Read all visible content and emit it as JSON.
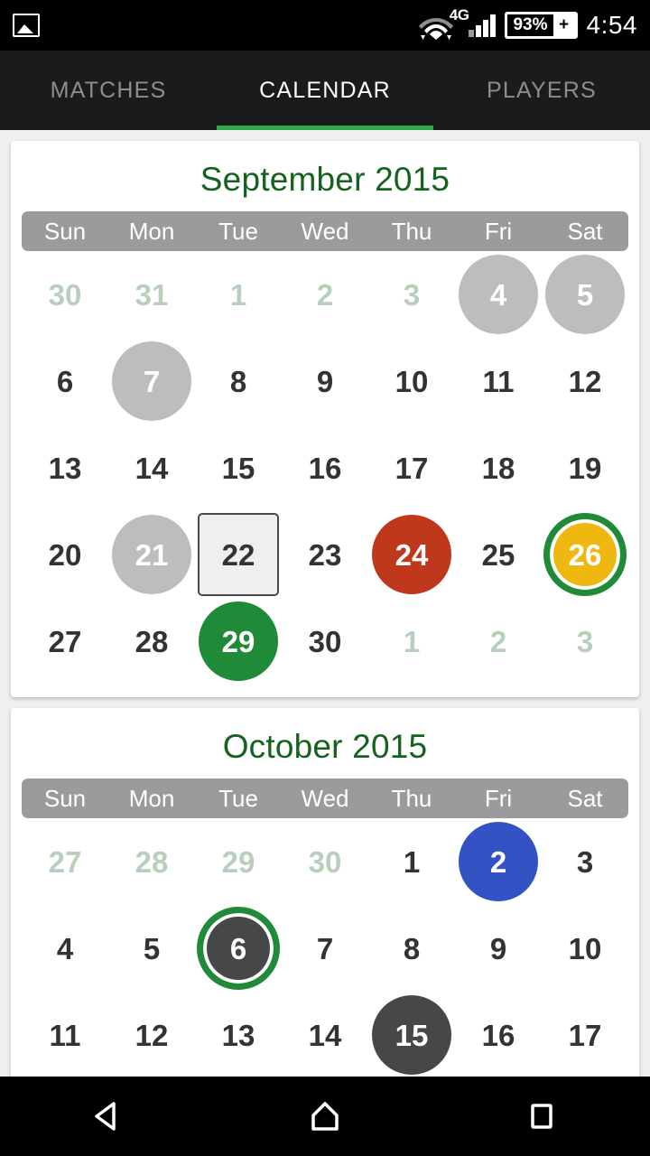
{
  "status_bar": {
    "photo_icon": "image-icon",
    "wifi_icon": "wifi-icon",
    "network_label": "4G",
    "signal_icon": "cellular-signal-icon",
    "battery_percent": "93%",
    "charging_symbol": "+",
    "time": "4:54"
  },
  "tabs": [
    {
      "label": "MATCHES",
      "active": false
    },
    {
      "label": "CALENDAR",
      "active": true
    },
    {
      "label": "PLAYERS",
      "active": false
    }
  ],
  "accent_color": "#2ea84a",
  "weekdays": [
    "Sun",
    "Mon",
    "Tue",
    "Wed",
    "Thu",
    "Fri",
    "Sat"
  ],
  "months": [
    {
      "title": "September 2015",
      "weeks": [
        [
          {
            "day": "30",
            "state": "other"
          },
          {
            "day": "31",
            "state": "other"
          },
          {
            "day": "1",
            "state": "other"
          },
          {
            "day": "2",
            "state": "other"
          },
          {
            "day": "3",
            "state": "other"
          },
          {
            "day": "4",
            "state": "gray"
          },
          {
            "day": "5",
            "state": "gray"
          }
        ],
        [
          {
            "day": "6",
            "state": "normal"
          },
          {
            "day": "7",
            "state": "gray"
          },
          {
            "day": "8",
            "state": "normal"
          },
          {
            "day": "9",
            "state": "normal"
          },
          {
            "day": "10",
            "state": "normal"
          },
          {
            "day": "11",
            "state": "normal"
          },
          {
            "day": "12",
            "state": "normal"
          }
        ],
        [
          {
            "day": "13",
            "state": "normal"
          },
          {
            "day": "14",
            "state": "normal"
          },
          {
            "day": "15",
            "state": "normal"
          },
          {
            "day": "16",
            "state": "normal"
          },
          {
            "day": "17",
            "state": "normal"
          },
          {
            "day": "18",
            "state": "normal"
          },
          {
            "day": "19",
            "state": "normal"
          }
        ],
        [
          {
            "day": "20",
            "state": "normal"
          },
          {
            "day": "21",
            "state": "gray"
          },
          {
            "day": "22",
            "state": "today"
          },
          {
            "day": "23",
            "state": "normal"
          },
          {
            "day": "24",
            "state": "red"
          },
          {
            "day": "25",
            "state": "normal"
          },
          {
            "day": "26",
            "state": "ring-gold"
          }
        ],
        [
          {
            "day": "27",
            "state": "normal"
          },
          {
            "day": "28",
            "state": "normal"
          },
          {
            "day": "29",
            "state": "green"
          },
          {
            "day": "30",
            "state": "normal"
          },
          {
            "day": "1",
            "state": "other"
          },
          {
            "day": "2",
            "state": "other"
          },
          {
            "day": "3",
            "state": "other"
          }
        ]
      ]
    },
    {
      "title": "October 2015",
      "weeks": [
        [
          {
            "day": "27",
            "state": "other"
          },
          {
            "day": "28",
            "state": "other"
          },
          {
            "day": "29",
            "state": "other"
          },
          {
            "day": "30",
            "state": "other"
          },
          {
            "day": "1",
            "state": "normal"
          },
          {
            "day": "2",
            "state": "blue"
          },
          {
            "day": "3",
            "state": "normal"
          }
        ],
        [
          {
            "day": "4",
            "state": "normal"
          },
          {
            "day": "5",
            "state": "normal"
          },
          {
            "day": "6",
            "state": "ring-dark"
          },
          {
            "day": "7",
            "state": "normal"
          },
          {
            "day": "8",
            "state": "normal"
          },
          {
            "day": "9",
            "state": "normal"
          },
          {
            "day": "10",
            "state": "normal"
          }
        ],
        [
          {
            "day": "11",
            "state": "normal"
          },
          {
            "day": "12",
            "state": "normal"
          },
          {
            "day": "13",
            "state": "normal"
          },
          {
            "day": "14",
            "state": "normal"
          },
          {
            "day": "15",
            "state": "dark"
          },
          {
            "day": "16",
            "state": "normal"
          },
          {
            "day": "17",
            "state": "normal"
          }
        ]
      ]
    }
  ],
  "nav_bar": {
    "back": "back-icon",
    "home": "home-icon",
    "recents": "recents-icon"
  }
}
